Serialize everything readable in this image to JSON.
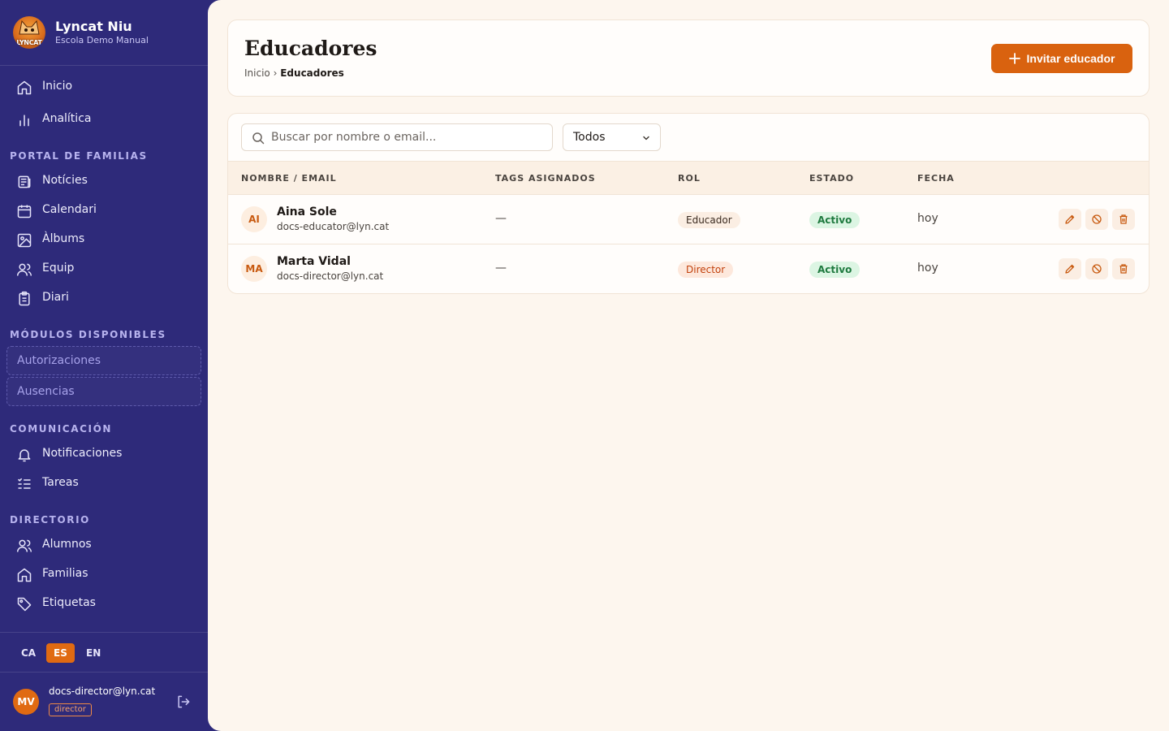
{
  "brand": {
    "title": "Lyncat Niu",
    "subtitle": "Escola Demo Manual",
    "logo_text": "LYNCAT"
  },
  "nav": {
    "top": [
      {
        "label": "Inicio",
        "icon": "home-icon"
      },
      {
        "label": "Analítica",
        "icon": "bar-chart-icon"
      }
    ],
    "sections": [
      {
        "title": "PORTAL DE FAMILIAS",
        "items": [
          {
            "label": "Notícies",
            "icon": "newspaper-icon"
          },
          {
            "label": "Calendari",
            "icon": "calendar-icon"
          },
          {
            "label": "Àlbums",
            "icon": "image-icon"
          },
          {
            "label": "Equip",
            "icon": "users-icon"
          },
          {
            "label": "Diari",
            "icon": "clipboard-icon"
          }
        ]
      },
      {
        "title": "MÓDULOS DISPONIBLES",
        "items": [
          {
            "label": "Autorizaciones"
          },
          {
            "label": "Ausencias"
          }
        ]
      },
      {
        "title": "COMUNICACIÓN",
        "items": [
          {
            "label": "Notificaciones",
            "icon": "bell-icon"
          },
          {
            "label": "Tareas",
            "icon": "list-check-icon"
          }
        ]
      },
      {
        "title": "DIRECTORIO",
        "items": [
          {
            "label": "Alumnos",
            "icon": "users-icon"
          },
          {
            "label": "Familias",
            "icon": "home-icon"
          },
          {
            "label": "Etiquetas",
            "icon": "tag-icon"
          }
        ]
      }
    ]
  },
  "languages": {
    "ca": "CA",
    "es": "ES",
    "en": "EN",
    "active": "ES"
  },
  "user": {
    "initials": "MV",
    "email": "docs-director@lyn.cat",
    "role": "director"
  },
  "page": {
    "title": "Educadores",
    "breadcrumb": {
      "home": "Inicio",
      "separator": "›",
      "current": "Educadores"
    },
    "invite_label": "Invitar educador"
  },
  "filters": {
    "search_placeholder": "Buscar por nombre o email...",
    "status_value": "Todos"
  },
  "table": {
    "headers": {
      "name": "NOMBRE / EMAIL",
      "tags": "TAGS ASIGNADOS",
      "role": "ROL",
      "status": "ESTADO",
      "date": "FECHA"
    },
    "rows": [
      {
        "initials": "AI",
        "name": "Aina Sole",
        "email": "docs-educator@lyn.cat",
        "tags": "—",
        "role": "Educador",
        "status": "Activo",
        "date": "hoy"
      },
      {
        "initials": "MA",
        "name": "Marta Vidal",
        "email": "docs-director@lyn.cat",
        "tags": "—",
        "role": "Director",
        "status": "Activo",
        "date": "hoy"
      }
    ]
  },
  "colors": {
    "sidebar": "#2e2a7a",
    "accent": "#d9620f",
    "background": "#fdf6ee",
    "success": "#1f7a3f"
  }
}
